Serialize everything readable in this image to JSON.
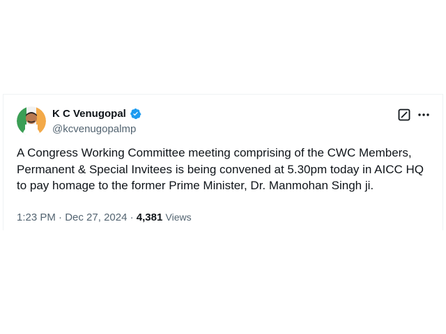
{
  "author": {
    "display_name": "K C Venugopal",
    "handle": "@kcvenugopalmp",
    "verified": true
  },
  "tweet": {
    "text": "A Congress Working Committee meeting comprising of the CWC Members, Permanent & Special Invitees is being convened at 5.30pm today in AICC HQ to pay homage to the former Prime Minister, Dr. Manmohan Singh ji."
  },
  "meta": {
    "time": "1:23 PM",
    "separator": "·",
    "date": "Dec 27, 2024",
    "views_count": "4,381",
    "views_label": "Views"
  },
  "icons": {
    "verified": "verified-badge-icon",
    "grok": "grok-icon",
    "more": "more-options-icon"
  },
  "colors": {
    "verified_blue": "#1d9bf0",
    "text_primary": "#0f1419",
    "text_secondary": "#536471"
  }
}
